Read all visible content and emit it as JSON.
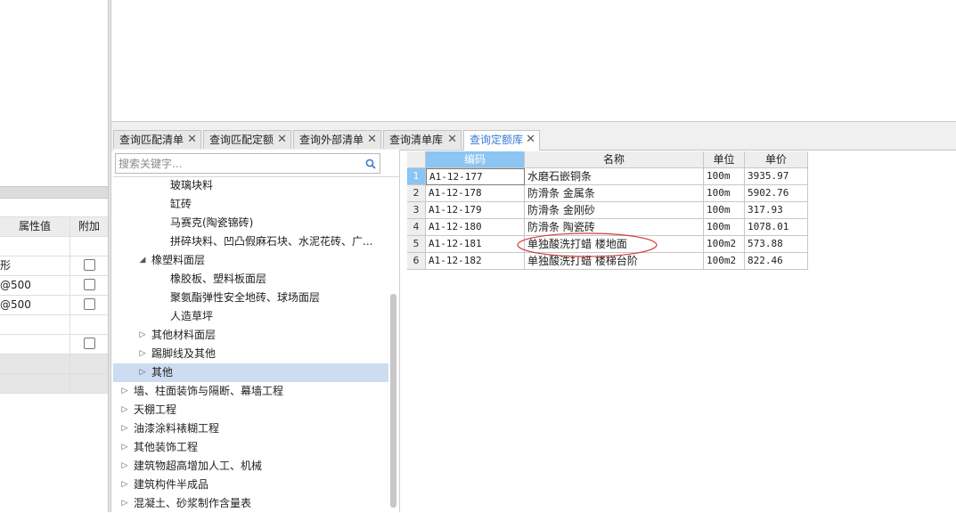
{
  "left_panel": {
    "header": {
      "col1": "属性值",
      "col2": "附加"
    },
    "rows": [
      {
        "value": "",
        "checkbox": false
      },
      {
        "value": "形",
        "checkbox": true
      },
      {
        "value": "@500",
        "checkbox": true
      },
      {
        "value": "@500",
        "checkbox": true
      },
      {
        "value": "",
        "checkbox": false
      },
      {
        "value": "",
        "checkbox": true
      },
      {
        "value": "",
        "checkbox": false
      },
      {
        "value": "",
        "checkbox": false
      }
    ]
  },
  "tabs": [
    {
      "label": "查询匹配清单",
      "close": "✕"
    },
    {
      "label": "查询匹配定额",
      "close": "✕"
    },
    {
      "label": "查询外部清单",
      "close": "✕"
    },
    {
      "label": "查询清单库",
      "close": "✕"
    },
    {
      "label": "查询定额库",
      "close": "✕",
      "active": true
    }
  ],
  "search": {
    "placeholder": "搜索关键字..."
  },
  "tree": [
    {
      "label": "玻璃块料",
      "level": 3,
      "arrow": ""
    },
    {
      "label": "缸砖",
      "level": 3,
      "arrow": ""
    },
    {
      "label": "马赛克(陶瓷锦砖)",
      "level": 3,
      "arrow": ""
    },
    {
      "label": "拼碎块料、凹凸假麻石块、水泥花砖、广...",
      "level": 3,
      "arrow": ""
    },
    {
      "label": "橡塑料面层",
      "level": 2,
      "arrow": "◢"
    },
    {
      "label": "橡胶板、塑料板面层",
      "level": 3,
      "arrow": ""
    },
    {
      "label": "聚氨酯弹性安全地砖、球场面层",
      "level": 3,
      "arrow": ""
    },
    {
      "label": "人造草坪",
      "level": 3,
      "arrow": ""
    },
    {
      "label": "其他材料面层",
      "level": 2,
      "arrow": "▷"
    },
    {
      "label": "踢脚线及其他",
      "level": 2,
      "arrow": "▷"
    },
    {
      "label": "其他",
      "level": 2,
      "arrow": "▷",
      "selected": true
    },
    {
      "label": "墙、柱面装饰与隔断、幕墙工程",
      "level": 1,
      "arrow": "▷"
    },
    {
      "label": "天棚工程",
      "level": 1,
      "arrow": "▷"
    },
    {
      "label": "油漆涂料裱糊工程",
      "level": 1,
      "arrow": "▷"
    },
    {
      "label": "其他装饰工程",
      "level": 1,
      "arrow": "▷"
    },
    {
      "label": "建筑物超高增加人工、机械",
      "level": 1,
      "arrow": "▷"
    },
    {
      "label": "建筑构件半成品",
      "level": 1,
      "arrow": "▷"
    },
    {
      "label": "混凝土、砂浆制作含量表",
      "level": 1,
      "arrow": "▷"
    }
  ],
  "grid": {
    "headers": {
      "code": "编码",
      "name": "名称",
      "unit": "单位",
      "price": "单价"
    },
    "rows": [
      {
        "n": "1",
        "code": "A1-12-177",
        "name": "水磨石嵌铜条",
        "unit": "100m",
        "price": "3935.97"
      },
      {
        "n": "2",
        "code": "A1-12-178",
        "name": "防滑条 金属条",
        "unit": "100m",
        "price": "5902.76"
      },
      {
        "n": "3",
        "code": "A1-12-179",
        "name": "防滑条 金刚砂",
        "unit": "100m",
        "price": "317.93"
      },
      {
        "n": "4",
        "code": "A1-12-180",
        "name": "防滑条 陶瓷砖",
        "unit": "100m",
        "price": "1078.01"
      },
      {
        "n": "5",
        "code": "A1-12-181",
        "name": "单独酸洗打蜡 楼地面",
        "unit": "100m2",
        "price": "573.88"
      },
      {
        "n": "6",
        "code": "A1-12-182",
        "name": "单独酸洗打蜡 楼梯台阶",
        "unit": "100m2",
        "price": "822.46"
      }
    ]
  },
  "colors": {
    "accent": "#3a7bd5",
    "header_blue": "#8cc4f4",
    "selection": "#cddcf0",
    "annotation": "#d23c3c"
  },
  "icons": {
    "search": "search-icon",
    "expanded": "triangle-expanded-icon",
    "collapsed": "triangle-collapsed-icon",
    "close": "close-icon"
  }
}
